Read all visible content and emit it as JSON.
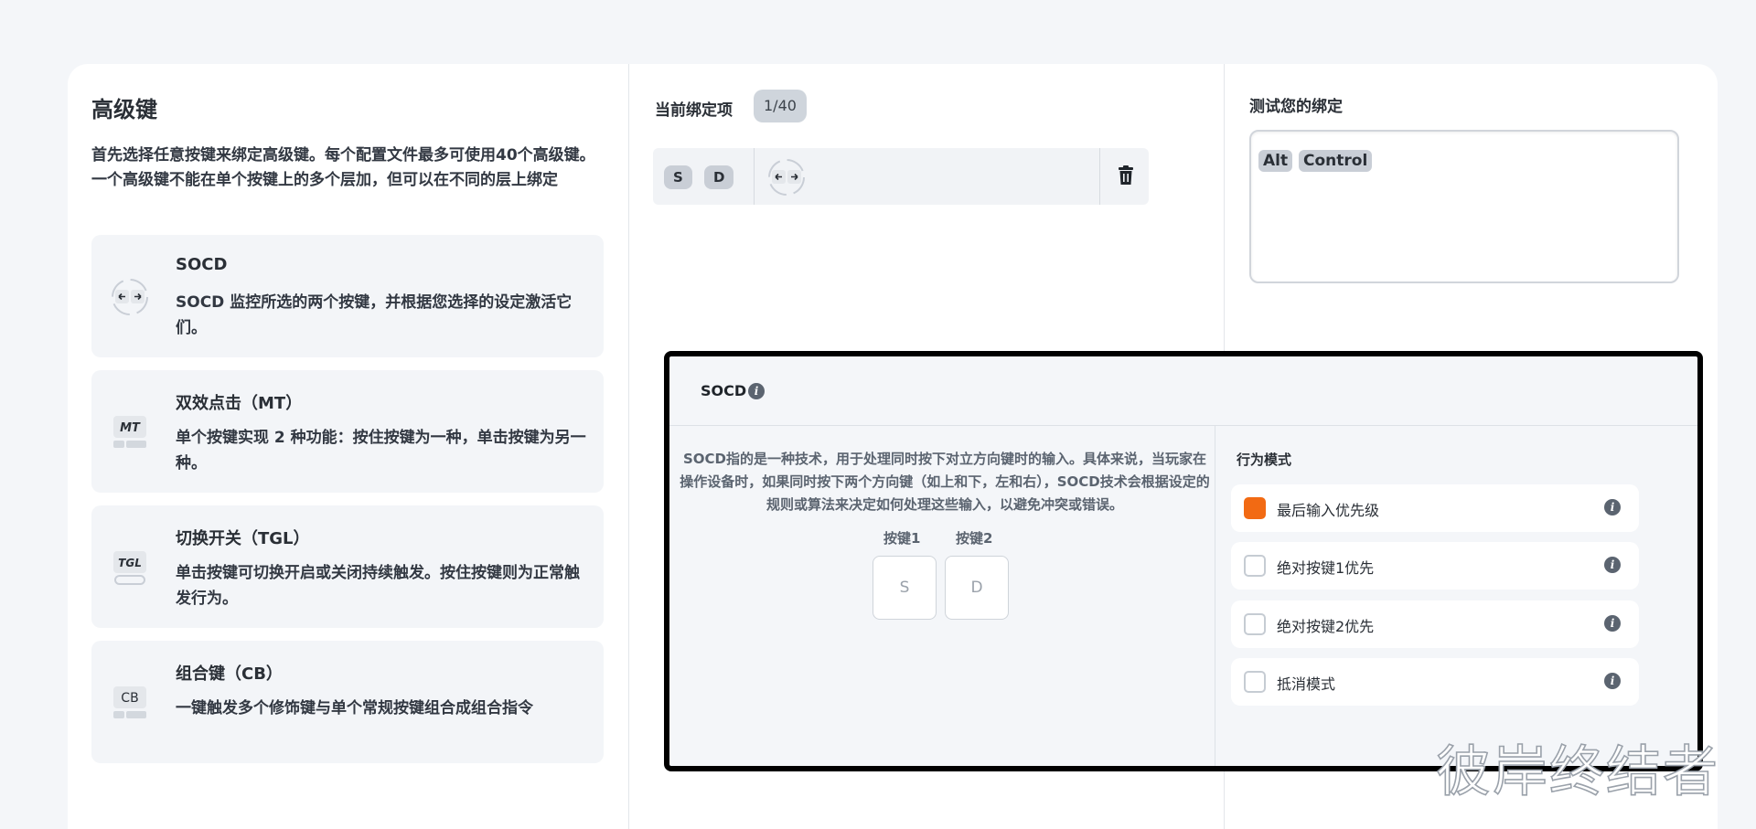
{
  "left": {
    "title": "高级键",
    "intro": "首先选择任意按键来绑定高级键。每个配置文件最多可使用40个高级键。一个高级键不能在单个按键上的多个层加，但可以在不同的层上绑定",
    "items": [
      {
        "title": "SOCD",
        "desc": "SOCD 监控所选的两个按键，并根据您选择的设定激活它们。",
        "icon": "socd-arrows-icon"
      },
      {
        "title": "双效点击（MT）",
        "desc": "单个按键实现 2 种功能：按住按键为一种，单击按键为另一种。",
        "icon_text": "MT",
        "icon": "mt-key-icon"
      },
      {
        "title": "切换开关（TGL）",
        "desc": "单击按键可切换开启或关闭持续触发。按住按键则为正常触发行为。",
        "icon_text": "TGL",
        "icon": "tgl-key-icon"
      },
      {
        "title": "组合键（CB）",
        "desc": "一键触发多个修饰键与单个常规按键组合成组合指令",
        "icon_text": "CB",
        "icon": "cb-key-icon"
      }
    ]
  },
  "middle": {
    "title": "当前绑定项",
    "count": "1/40",
    "binding": {
      "key1": "S",
      "key2": "D",
      "icon": "socd-arrows-icon",
      "delete_icon": "trash-icon"
    }
  },
  "right": {
    "title": "测试您的绑定",
    "keys": [
      "Alt",
      "Control"
    ]
  },
  "panel": {
    "title": "SOCD",
    "description": "SOCD指的是一种技术，用于处理同时按下对立方向键时的输入。具体来说，当玩家在操作设备时，如果同时按下两个方向键（如上和下，左和右），SOCD技术会根据设定的规则或算法来决定如何处理这些输入，以避免冲突或错误。",
    "key1_label": "按键1",
    "key2_label": "按键2",
    "key1_value": "S",
    "key2_value": "D",
    "mode_title": "行为模式",
    "options": [
      {
        "label": "最后输入优先级",
        "checked": true
      },
      {
        "label": "绝对按键1优先",
        "checked": false
      },
      {
        "label": "绝对按键2优先",
        "checked": false
      },
      {
        "label": "抵消模式",
        "checked": false
      }
    ],
    "accent": "#f26a13"
  },
  "watermark": "彼岸终结者"
}
